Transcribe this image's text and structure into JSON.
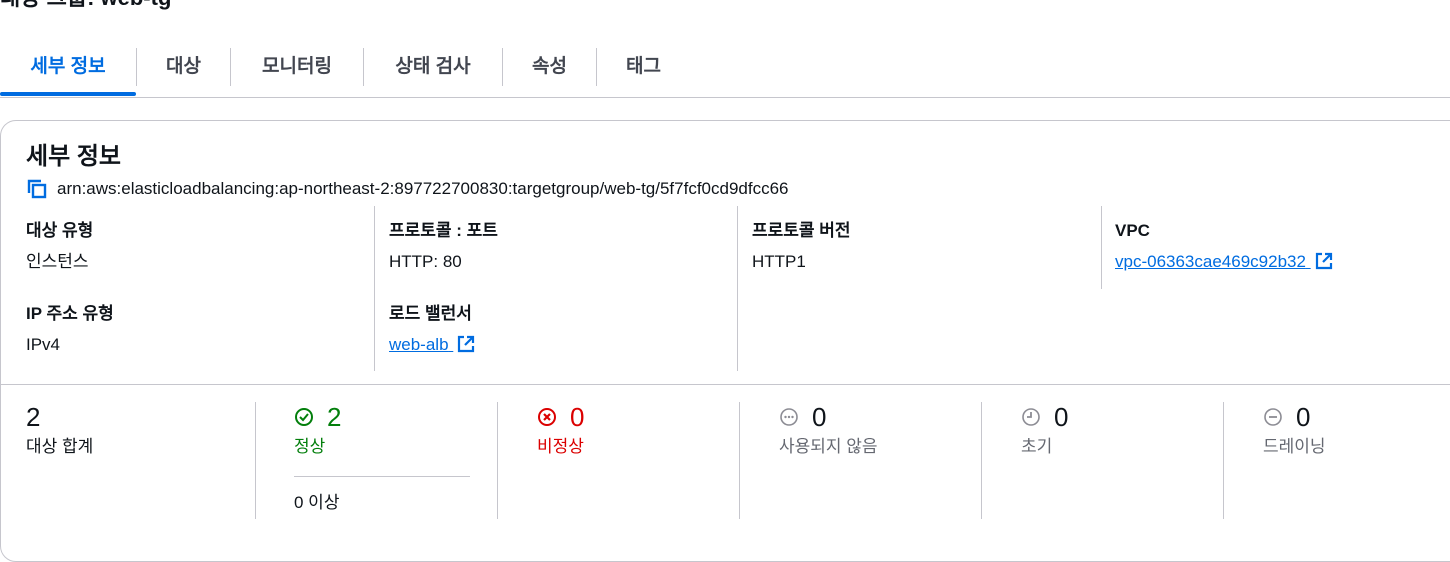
{
  "header": {
    "title": "대상 그룹: web-tg"
  },
  "tabs": [
    {
      "label": "세부 정보",
      "active": true
    },
    {
      "label": "대상"
    },
    {
      "label": "모니터링"
    },
    {
      "label": "상태 검사"
    },
    {
      "label": "속성"
    },
    {
      "label": "태그"
    }
  ],
  "details": {
    "title": "세부 정보",
    "arn": "arn:aws:elasticloadbalancing:ap-northeast-2:897722700830:targetgroup/web-tg/5f7fcf0cd9dfcc66",
    "target_type_label": "대상 유형",
    "target_type_value": "인스턴스",
    "protocol_port_label": "프로토콜 : 포트",
    "protocol_port_value": "HTTP: 80",
    "protocol_version_label": "프로토콜 버전",
    "protocol_version_value": "HTTP1",
    "vpc_label": "VPC",
    "vpc_value": "vpc-06363cae469c92b32",
    "ip_type_label": "IP 주소 유형",
    "ip_type_value": "IPv4",
    "lb_label": "로드 밸런서",
    "lb_value": "web-alb"
  },
  "stats": {
    "total": {
      "value": "2",
      "label": "대상 합계"
    },
    "healthy": {
      "value": "2",
      "label": "정상",
      "sub": "0 이상"
    },
    "unhealthy": {
      "value": "0",
      "label": "비정상"
    },
    "unused": {
      "value": "0",
      "label": "사용되지 않음"
    },
    "initial": {
      "value": "0",
      "label": "초기"
    },
    "draining": {
      "value": "0",
      "label": "드레이닝"
    }
  },
  "colors": {
    "accent": "#006ce0",
    "healthy": "#037f0c",
    "unhealthy": "#db0000",
    "neutral": "#656871"
  },
  "icons": {
    "copy": "copy-icon",
    "external": "external-link-icon",
    "healthy": "check-circle-icon",
    "unhealthy": "x-circle-icon",
    "unused": "ellipsis-circle-icon",
    "initial": "clock-icon",
    "draining": "minus-circle-icon"
  }
}
